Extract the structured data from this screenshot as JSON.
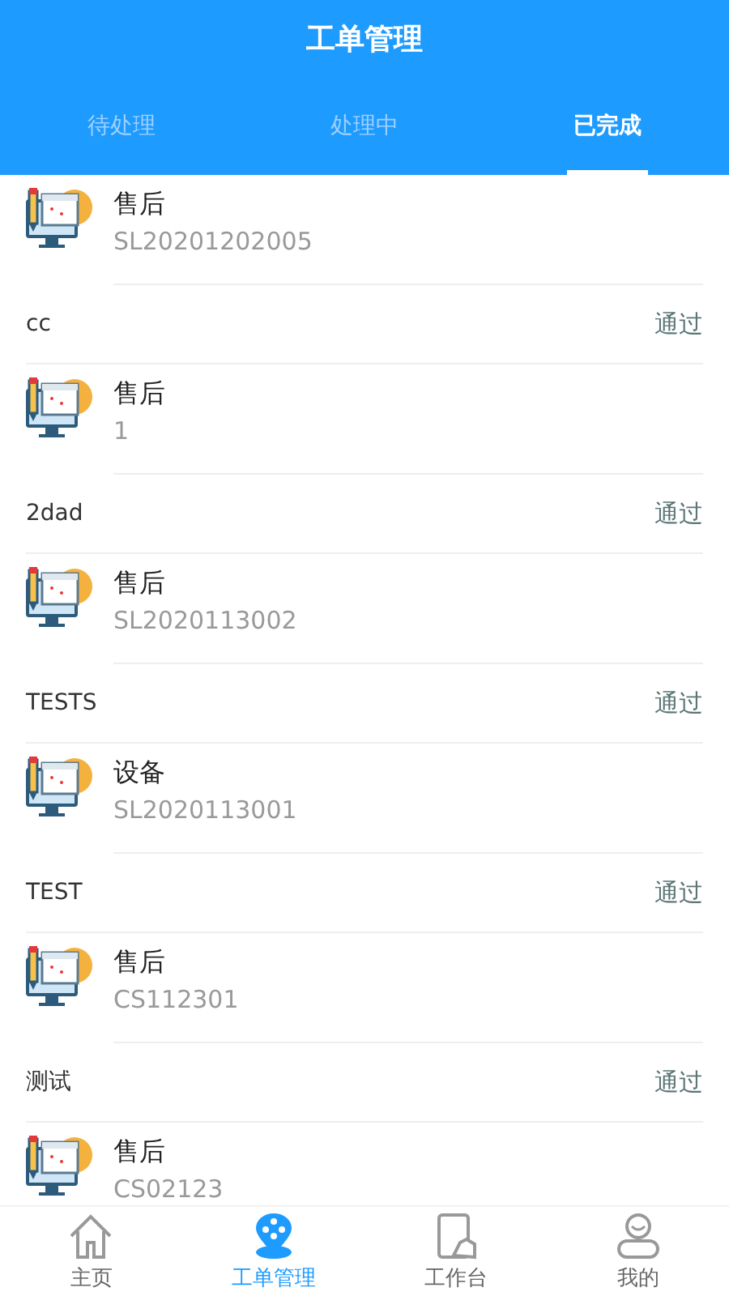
{
  "header": {
    "title": "工单管理"
  },
  "tabs": [
    {
      "label": "待处理",
      "selected": false
    },
    {
      "label": "处理中",
      "selected": false
    },
    {
      "label": "已完成",
      "selected": true
    }
  ],
  "orders": [
    {
      "type": "售后",
      "code": "SL20201202005",
      "name": "cc",
      "status": "通过"
    },
    {
      "type": "售后",
      "code": "1",
      "name": "2dad",
      "status": "通过"
    },
    {
      "type": "售后",
      "code": "SL2020113002",
      "name": "TESTS",
      "status": "通过"
    },
    {
      "type": "设备",
      "code": "SL2020113001",
      "name": "TEST",
      "status": "通过"
    },
    {
      "type": "售后",
      "code": "CS112301",
      "name": "测试",
      "status": "通过"
    },
    {
      "type": "售后",
      "code": "CS02123"
    }
  ],
  "bottom_nav": [
    {
      "kind": "home",
      "label": "主页",
      "selected": false
    },
    {
      "kind": "pin",
      "label": "工单管理",
      "selected": true
    },
    {
      "kind": "phone",
      "label": "工作台",
      "selected": false
    },
    {
      "kind": "user",
      "label": "我的",
      "selected": false
    }
  ]
}
